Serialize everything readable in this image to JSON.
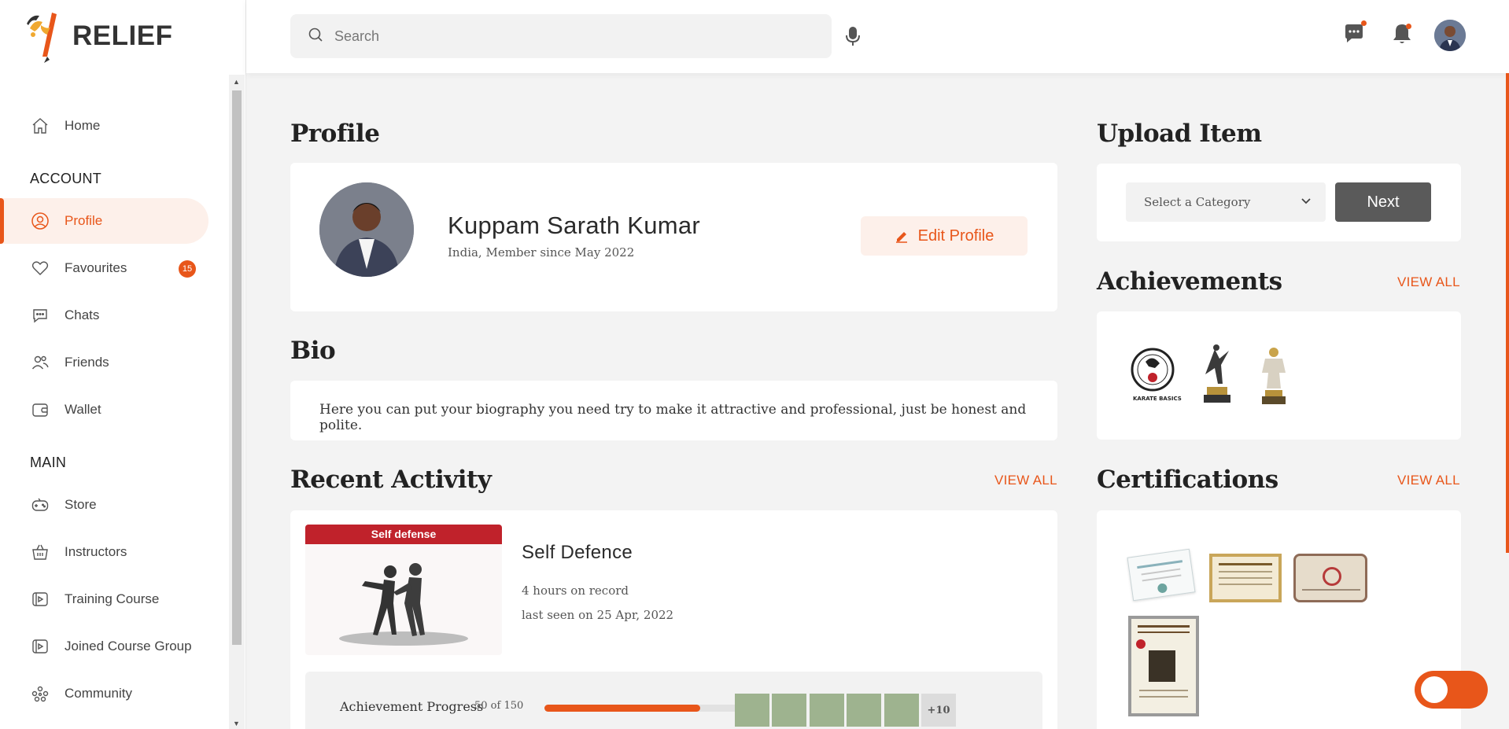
{
  "brand": {
    "name": "RELIEF"
  },
  "search": {
    "placeholder": "Search"
  },
  "sidebar": {
    "home": "Home",
    "account_heading": "ACCOUNT",
    "profile": "Profile",
    "favourites": "Favourites",
    "favourites_badge": "15",
    "chats": "Chats",
    "friends": "Friends",
    "wallet": "Wallet",
    "main_heading": "MAIN",
    "store": "Store",
    "instructors": "Instructors",
    "training_course": "Training Course",
    "joined_course_group": "Joined Course Group",
    "community": "Community"
  },
  "profile": {
    "heading": "Profile",
    "name": "Kuppam Sarath Kumar",
    "subtitle": "India, Member since May 2022",
    "edit_label": "Edit Profile"
  },
  "bio": {
    "heading": "Bio",
    "text": "Here you can put your biography you need try to make it attractive and professional, just be honest and polite."
  },
  "activity": {
    "heading": "Recent Activity",
    "view_all": "VIEW ALL",
    "tag": "Self defense",
    "title": "Self Defence",
    "hours": "4 hours on record",
    "last_seen": "last seen on 25 Apr, 2022",
    "progress_label": "Achievement Progress",
    "progress_count": "50 of 150",
    "progress_fraction": 0.79,
    "more_label": "+10"
  },
  "upload": {
    "heading": "Upload Item",
    "select_value": "Select a Category",
    "next_label": "Next"
  },
  "achievements": {
    "heading": "Achievements",
    "view_all": "VIEW ALL",
    "logo_text": "KARATE BASICS"
  },
  "certifications": {
    "heading": "Certifications",
    "view_all": "VIEW ALL"
  },
  "colors": {
    "accent": "#e8561a",
    "button_dark": "#5a5a5a",
    "tag_red": "#c0222b"
  }
}
